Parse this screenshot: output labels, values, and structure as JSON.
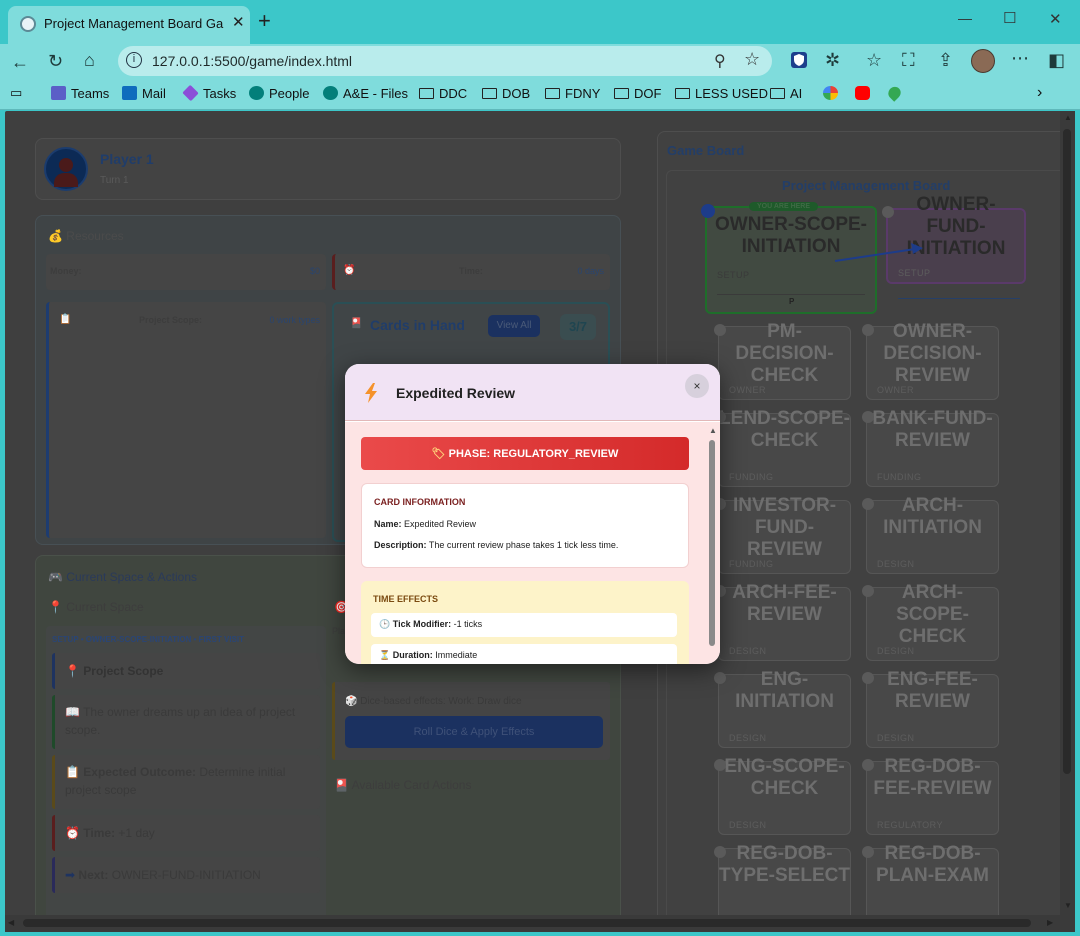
{
  "browser": {
    "tab_title": "Project Management Board Game",
    "url": "127.0.0.1:5500/game/index.html",
    "bookmarks": [
      {
        "label": "Teams",
        "icon": "teams-icon"
      },
      {
        "label": "Mail",
        "icon": "outlook-icon"
      },
      {
        "label": "Tasks",
        "icon": "tasks-icon"
      },
      {
        "label": "People",
        "icon": "sharepoint-icon"
      },
      {
        "label": "A&E - Files",
        "icon": "sharepoint-icon"
      },
      {
        "label": "DDC",
        "icon": "folder-icon"
      },
      {
        "label": "DOB",
        "icon": "folder-icon"
      },
      {
        "label": "FDNY",
        "icon": "folder-icon"
      },
      {
        "label": "DOF",
        "icon": "folder-icon"
      },
      {
        "label": "LESS USED",
        "icon": "folder-icon"
      },
      {
        "label": "AI",
        "icon": "folder-icon"
      }
    ]
  },
  "player": {
    "name": "Player 1",
    "turn": "Turn 1"
  },
  "resources": {
    "title": "Resources",
    "money_label": "Money:",
    "money_value": "$0",
    "time_label": "Time:",
    "time_value": "0 days",
    "scope_label": "Project Scope:",
    "scope_value": "0 work types"
  },
  "hand": {
    "title": "Cards in Hand",
    "view_all": "View All",
    "count": "3/7"
  },
  "space_actions": {
    "title": "Current Space & Actions",
    "current_space": "Current Space",
    "breadcrumb": "SETUP • OWNER-SCOPE-INITIATION • FIRST VISIT",
    "items": [
      {
        "bold": "Project Scope",
        "text": ""
      },
      {
        "bold": "",
        "text": "The owner dreams up an idea of project scope."
      },
      {
        "bold": "Expected Outcome:",
        "text": " Determine initial project scope"
      },
      {
        "bold": "Time:",
        "text": " +1 day"
      },
      {
        "bold": "Next:",
        "text": " OWNER-FUND-INITIATION"
      }
    ],
    "play_fragment": "Pla",
    "dice_effects": "Dice-based effects: Work: Draw dice",
    "roll_button": "Roll Dice & Apply Effects",
    "available_actions": "Available Card Actions"
  },
  "board": {
    "section_title": "Game Board",
    "title": "Project Management Board",
    "you_are_here": "YOU ARE HERE",
    "current_marker": "P",
    "spaces": [
      {
        "name": "OWNER-SCOPE-INITIATION",
        "phase": "SETUP"
      },
      {
        "name": "OWNER-FUND-INITIATION",
        "phase": "SETUP"
      },
      {
        "name": "PM-DECISION-CHECK",
        "phase": "OWNER"
      },
      {
        "name": "OWNER-DECISION-REVIEW",
        "phase": "OWNER"
      },
      {
        "name": "LEND-SCOPE-CHECK",
        "phase": "FUNDING"
      },
      {
        "name": "BANK-FUND-REVIEW",
        "phase": "FUNDING"
      },
      {
        "name": "INVESTOR-FUND-REVIEW",
        "phase": "FUNDING"
      },
      {
        "name": "ARCH-INITIATION",
        "phase": "DESIGN"
      },
      {
        "name": "ARCH-FEE-REVIEW",
        "phase": "DESIGN"
      },
      {
        "name": "ARCH-SCOPE-CHECK",
        "phase": "DESIGN"
      },
      {
        "name": "ENG-INITIATION",
        "phase": "DESIGN"
      },
      {
        "name": "ENG-FEE-REVIEW",
        "phase": "DESIGN"
      },
      {
        "name": "ENG-SCOPE-CHECK",
        "phase": "DESIGN"
      },
      {
        "name": "REG-DOB-FEE-REVIEW",
        "phase": "REGULATORY"
      },
      {
        "name": "REG-DOB-TYPE-SELECT",
        "phase": ""
      },
      {
        "name": "REG-DOB-PLAN-EXAM",
        "phase": ""
      }
    ]
  },
  "modal": {
    "title": "Expedited Review",
    "close": "×",
    "phase_banner": "PHASE: REGULATORY_REVIEW",
    "card_info_title": "CARD INFORMATION",
    "name_label": "Name:",
    "name_value": " Expedited Review",
    "desc_label": "Description:",
    "desc_value": " The current review phase takes 1 tick less time.",
    "time_effects_title": "TIME EFFECTS",
    "tick_label": "Tick Modifier:",
    "tick_value": " -1 ticks",
    "duration_label": "Duration:",
    "duration_value": " Immediate"
  }
}
